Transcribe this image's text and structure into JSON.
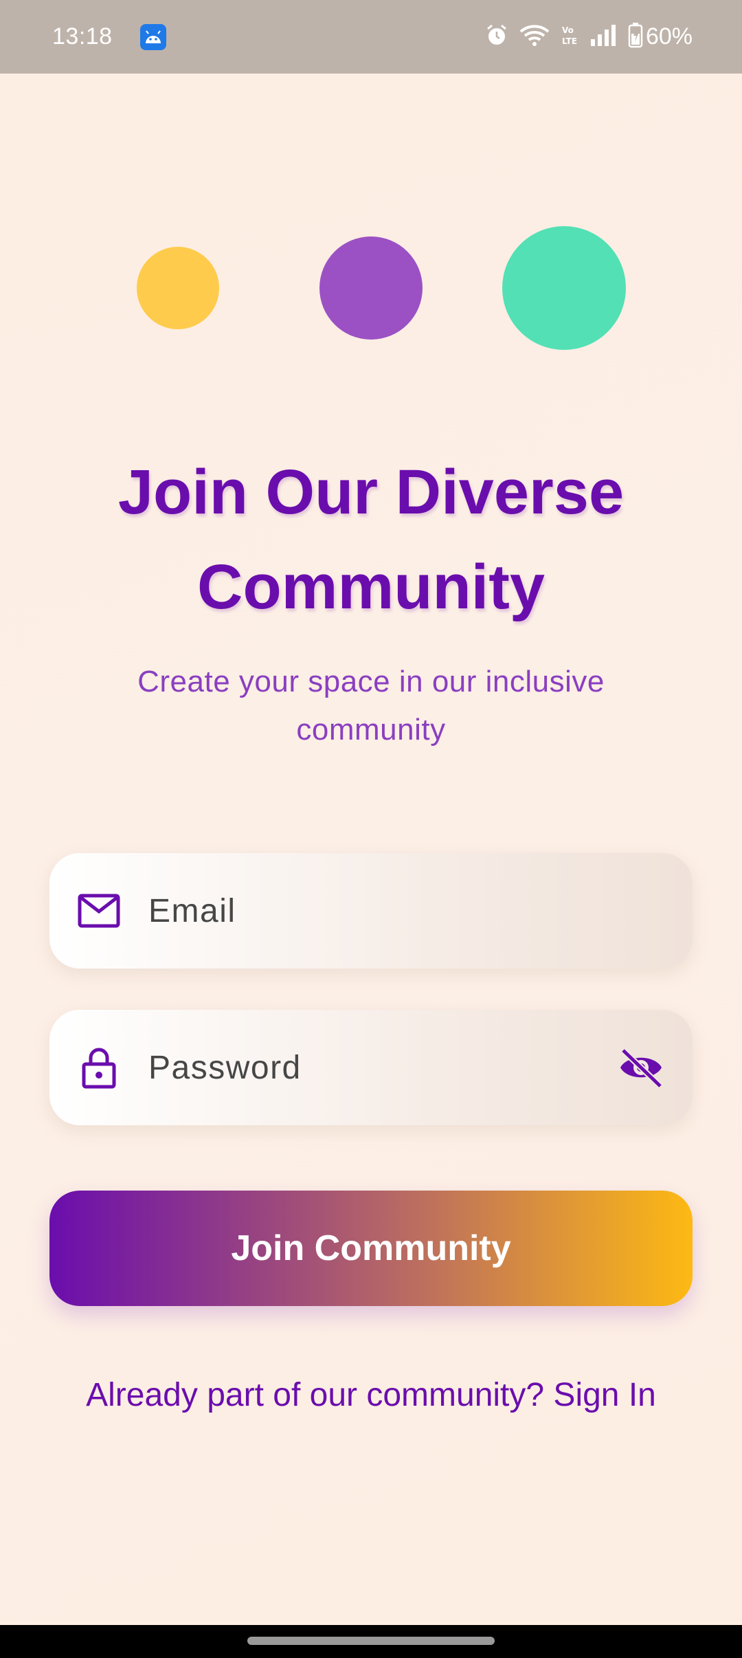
{
  "status_bar": {
    "time": "13:18",
    "battery_text": "60%",
    "icons": [
      "android-icon",
      "alarm-icon",
      "wifi-icon",
      "volte-icon",
      "signal-icon",
      "battery-icon"
    ]
  },
  "decor": {
    "circle_colors": [
      "#fecb4c",
      "#9b51c4",
      "#52e0b4"
    ]
  },
  "header": {
    "title": "Join Our Diverse Community",
    "subtitle": "Create your space in our inclusive community"
  },
  "form": {
    "email_placeholder": "Email",
    "email_icon": "mail-icon",
    "password_placeholder": "Password",
    "password_icon": "lock-icon",
    "visibility_icon": "eye-off-icon",
    "submit_label": "Join Community"
  },
  "footer": {
    "signin_text": "Already part of our community? Sign In"
  },
  "colors": {
    "accent": "#6a0dad",
    "gradient_end": "#fdb913",
    "background": "#fdefe4"
  }
}
